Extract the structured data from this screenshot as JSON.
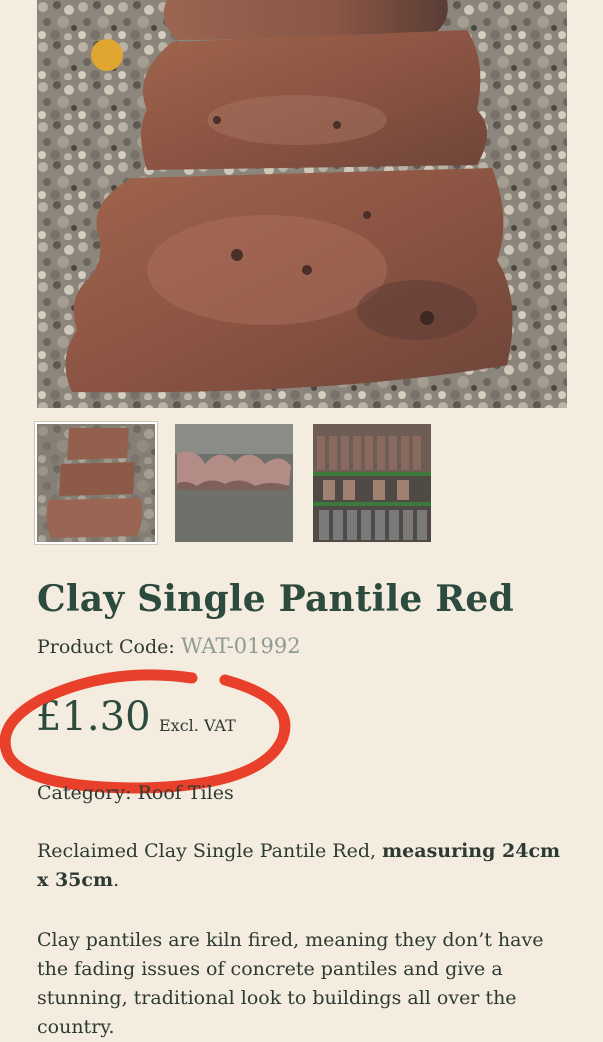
{
  "product": {
    "title": "Clay Single Pantile Red",
    "code_label": "Product Code:",
    "code_value": "WAT-01992",
    "price": "£1.30",
    "vat_label": "Excl. VAT",
    "category_label": "Category:",
    "category_value": "Roof Tiles",
    "description_1_plain": "Reclaimed Clay Single Pantile Red, ",
    "description_1_bold": "measuring 24cm x 35cm",
    "description_1_end": ".",
    "description_2": "Clay pantiles are kiln fired, meaning they don’t have the fading issues of concrete pantiles and give a stunning, traditional look to buildings all over the country."
  },
  "gallery": {
    "main_image": "pantile-stack-on-gravel-photo",
    "thumbnails": [
      {
        "name": "pantile-stack-thumbnail",
        "active": true
      },
      {
        "name": "pantile-profile-thumbnail",
        "active": false
      },
      {
        "name": "pantile-rack-thumbnail",
        "active": false
      }
    ]
  },
  "colors": {
    "background": "#f3ecdf",
    "title": "#2c4a3d",
    "code_value": "#8f9a94",
    "annotation_circle": "#e8402a"
  }
}
